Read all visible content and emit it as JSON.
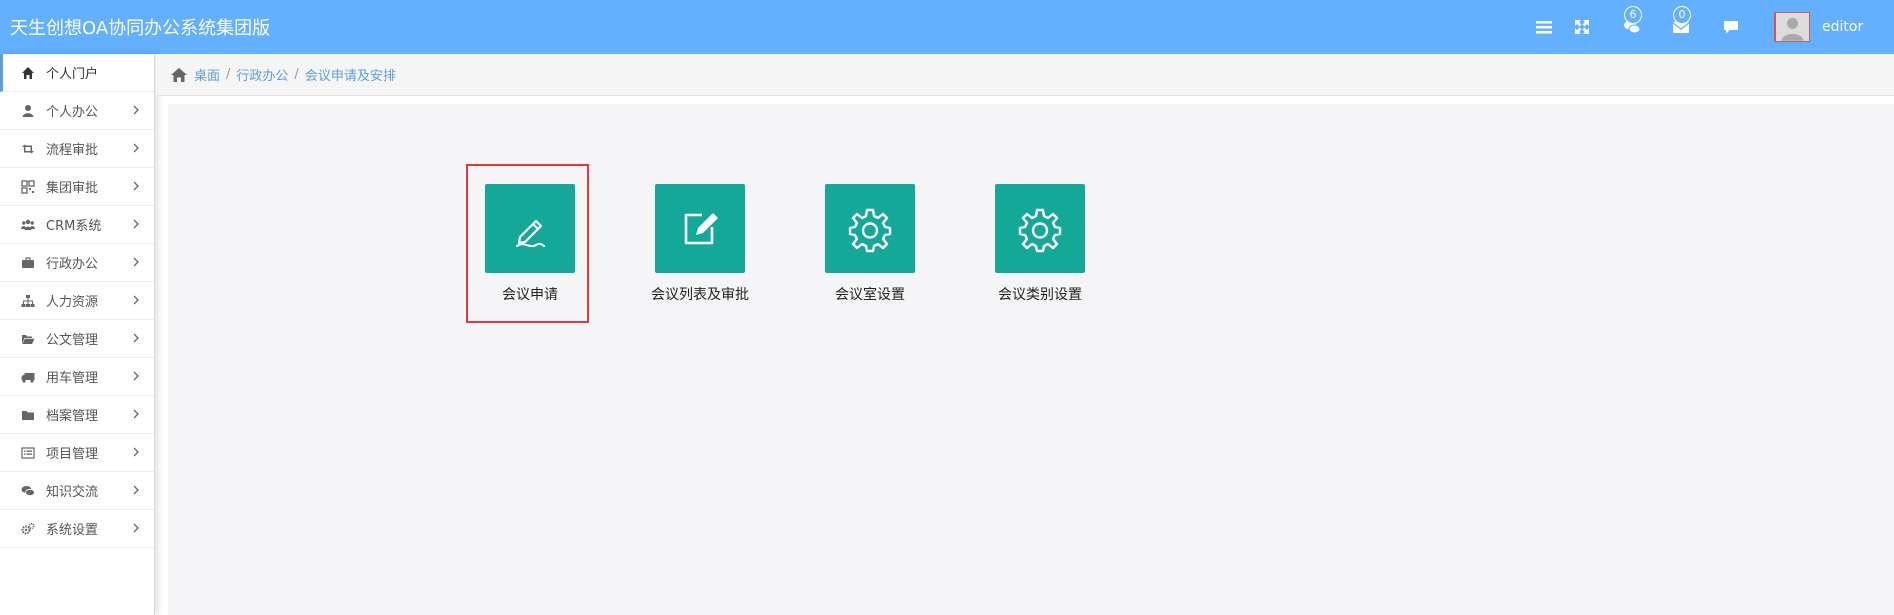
{
  "app": {
    "title": "天生创想OA协同办公系统集团版"
  },
  "header": {
    "icons": [
      "menu-icon",
      "fullscreen-icon",
      "chat-icon",
      "mail-icon",
      "comment-icon"
    ],
    "chat_badge": "6",
    "mail_badge": "0",
    "user": "editor"
  },
  "sidebar": {
    "items": [
      {
        "label": "个人门户",
        "icon": "home-icon",
        "active": true
      },
      {
        "label": "个人办公",
        "icon": "user-icon"
      },
      {
        "label": "流程审批",
        "icon": "retweet-icon"
      },
      {
        "label": "集团审批",
        "icon": "qrcode-icon"
      },
      {
        "label": "CRM系统",
        "icon": "group-icon"
      },
      {
        "label": "行政办公",
        "icon": "briefcase-icon"
      },
      {
        "label": "人力资源",
        "icon": "sitemap-icon"
      },
      {
        "label": "公文管理",
        "icon": "folder-open-icon"
      },
      {
        "label": "用车管理",
        "icon": "truck-icon"
      },
      {
        "label": "档案管理",
        "icon": "folder-icon"
      },
      {
        "label": "项目管理",
        "icon": "list-alt-icon"
      },
      {
        "label": "知识交流",
        "icon": "comments-icon"
      },
      {
        "label": "系统设置",
        "icon": "cogs-icon"
      }
    ]
  },
  "breadcrumb": [
    "桌面",
    "行政办公",
    "会议申请及安排"
  ],
  "tiles": [
    {
      "label": "会议申请",
      "icon": "pen-icon"
    },
    {
      "label": "会议列表及审批",
      "icon": "edit-icon"
    },
    {
      "label": "会议室设置",
      "icon": "gear-icon"
    },
    {
      "label": "会议类别设置",
      "icon": "gear-icon"
    }
  ],
  "colors": {
    "topbar": "#62b0ff",
    "tile": "#13a898",
    "link": "#5b9fe0",
    "highlight": "#e23a3a"
  }
}
